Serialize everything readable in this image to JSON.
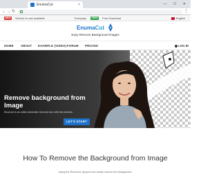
{
  "browser": {
    "tab_title": "EnumaCut",
    "tab_close": "×",
    "window_controls": "— ☐ ✕",
    "menu": "⋮"
  },
  "infobar": {
    "badge_new": "NEW",
    "new_text": "Service is now available",
    "everyday_text": "Everyday",
    "badge_free": "FREE",
    "free_text": "Free Download",
    "language": "English"
  },
  "logo": {
    "enuma": "Enuma",
    "cut": "Cut",
    "tagline": "Easy Remove Background Images"
  },
  "nav": {
    "items": [
      "HOME",
      "ABOUT",
      "EXAMPLE (VIDEO)",
      "FORUM",
      "PRICING"
    ],
    "login": "LOG IN"
  },
  "hero": {
    "title": "Remove background from Image",
    "description": "Enumcut is an online automatic removal tool, with live preview.",
    "cta": "LET'S START"
  },
  "section": {
    "title": "How To Remove the Background from Image",
    "subtitle": "Using the Enumcut, Anyone can easily remove the background."
  },
  "colors": {
    "brand_blue": "#1f72c9",
    "badge_red": "#d9322b",
    "badge_green": "#2b9e44"
  }
}
